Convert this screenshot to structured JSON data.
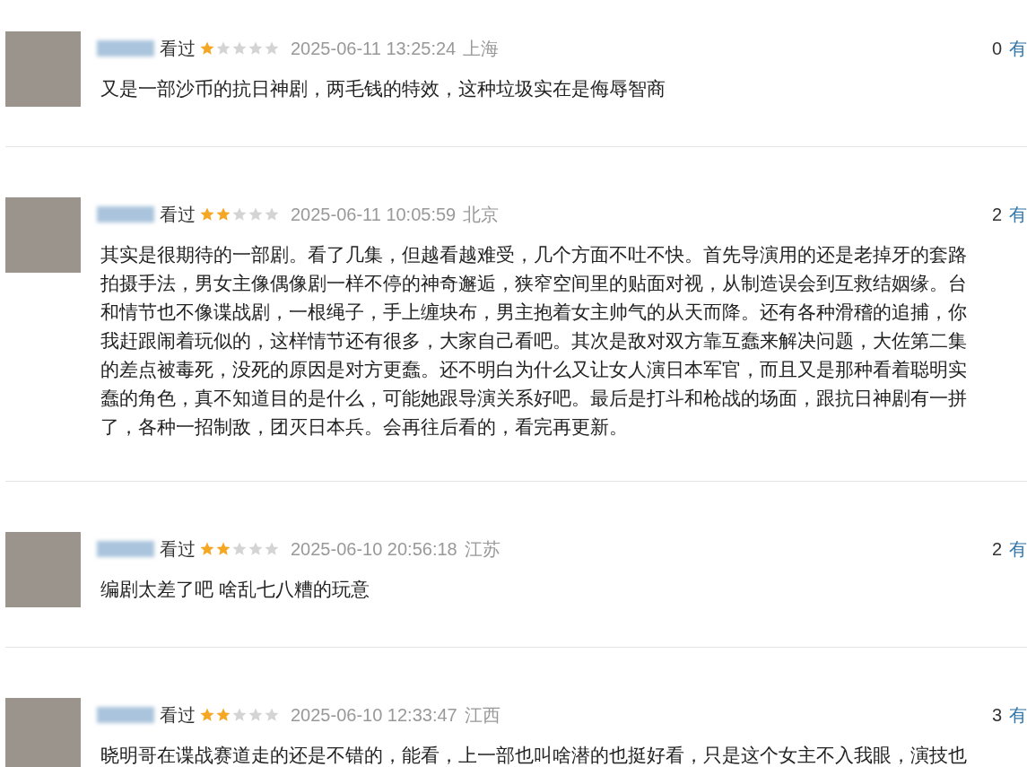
{
  "reviews": [
    {
      "status": "看过",
      "stars": 1,
      "time": "2025-06-11 13:25:24",
      "location": "上海",
      "votes": "0",
      "vote_label": "有",
      "lines": [
        "又是一部沙币的抗日神剧，两毛钱的特效，这种垃圾实在是侮辱智商"
      ]
    },
    {
      "status": "看过",
      "stars": 2,
      "time": "2025-06-11 10:05:59",
      "location": "北京",
      "votes": "2",
      "vote_label": "有",
      "lines": [
        "其实是很期待的一部剧。看了几集，但越看越难受，几个方面不吐不快。首先导演用的还是老掉牙的套路",
        "拍摄手法，男女主像偶像剧一样不停的神奇邂逅，狭窄空间里的贴面对视，从制造误会到互救结姻缘。台",
        "和情节也不像谍战剧，一根绳子，手上缠块布，男主抱着女主帅气的从天而降。还有各种滑稽的追捕，你",
        "我赶跟闹着玩似的，这样情节还有很多，大家自己看吧。其次是敌对双方靠互蠢来解决问题，大佐第二集",
        "的差点被毒死，没死的原因是对方更蠢。还不明白为什么又让女人演日本军官，而且又是那种看着聪明实",
        "蠢的角色，真不知道目的是什么，可能她跟导演关系好吧。最后是打斗和枪战的场面，跟抗日神剧有一拼",
        "了，各种一招制敌，团灭日本兵。会再往后看的，看完再更新。"
      ]
    },
    {
      "status": "看过",
      "stars": 2,
      "time": "2025-06-10 20:56:18",
      "location": "江苏",
      "votes": "2",
      "vote_label": "有",
      "lines": [
        "编剧太差了吧 啥乱七八糟的玩意"
      ]
    },
    {
      "status": "看过",
      "stars": 2,
      "time": "2025-06-10 12:33:47",
      "location": "江西",
      "votes": "3",
      "vote_label": "有",
      "lines": [
        "晓明哥在谍战赛道走的还是不错的，能看，上一部也叫啥潜的也挺好看，只是这个女主不入我眼，演技也"
      ]
    }
  ]
}
